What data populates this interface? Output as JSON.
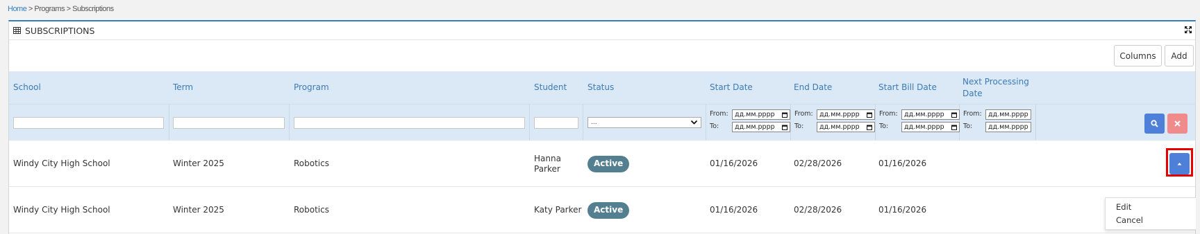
{
  "breadcrumb": {
    "home": "Home",
    "sep": " > ",
    "programs": "Programs",
    "current": "Subscriptions"
  },
  "panel": {
    "title": "SUBSCRIPTIONS"
  },
  "toolbar": {
    "columns_label": "Columns",
    "add_label": "Add"
  },
  "columns": [
    "School",
    "Term",
    "Program",
    "Student",
    "Status",
    "Start Date",
    "End Date",
    "Start Bill Date",
    "Next Processing Date"
  ],
  "filters": {
    "status_selected": "...",
    "from_label": "From:",
    "to_label": "To:",
    "date_placeholder_from": "дд.мм.рррр",
    "date_placeholder_to": "дд.мм.рррр"
  },
  "rows": [
    {
      "school": "Windy City High School",
      "term": "Winter 2025",
      "program": "Robotics",
      "student": "Hanna Parker",
      "status": "Active",
      "start_date": "01/16/2026",
      "end_date": "02/28/2026",
      "start_bill_date": "01/16/2026",
      "next_processing_date": ""
    },
    {
      "school": "Windy City High School",
      "term": "Winter 2025",
      "program": "Robotics",
      "student": "Katy Parker",
      "status": "Active",
      "start_date": "01/16/2026",
      "end_date": "02/28/2026",
      "start_bill_date": "01/16/2026",
      "next_processing_date": ""
    }
  ],
  "row_menu": {
    "edit": "Edit",
    "cancel": "Cancel"
  },
  "colors": {
    "accent": "#2f7fc1",
    "header_bg": "#dbe8f5",
    "primary_button": "#4e7fd9",
    "danger_button": "#f18b8b",
    "status_badge": "#537f91",
    "highlight": "#e60000"
  },
  "icons": {
    "panel": "table-grid-icon",
    "expand": "expand-icon",
    "search": "search-icon",
    "clear": "close-icon",
    "row_action": "caret-up-icon",
    "select": "chevron-down-icon",
    "date": "calendar-icon"
  }
}
